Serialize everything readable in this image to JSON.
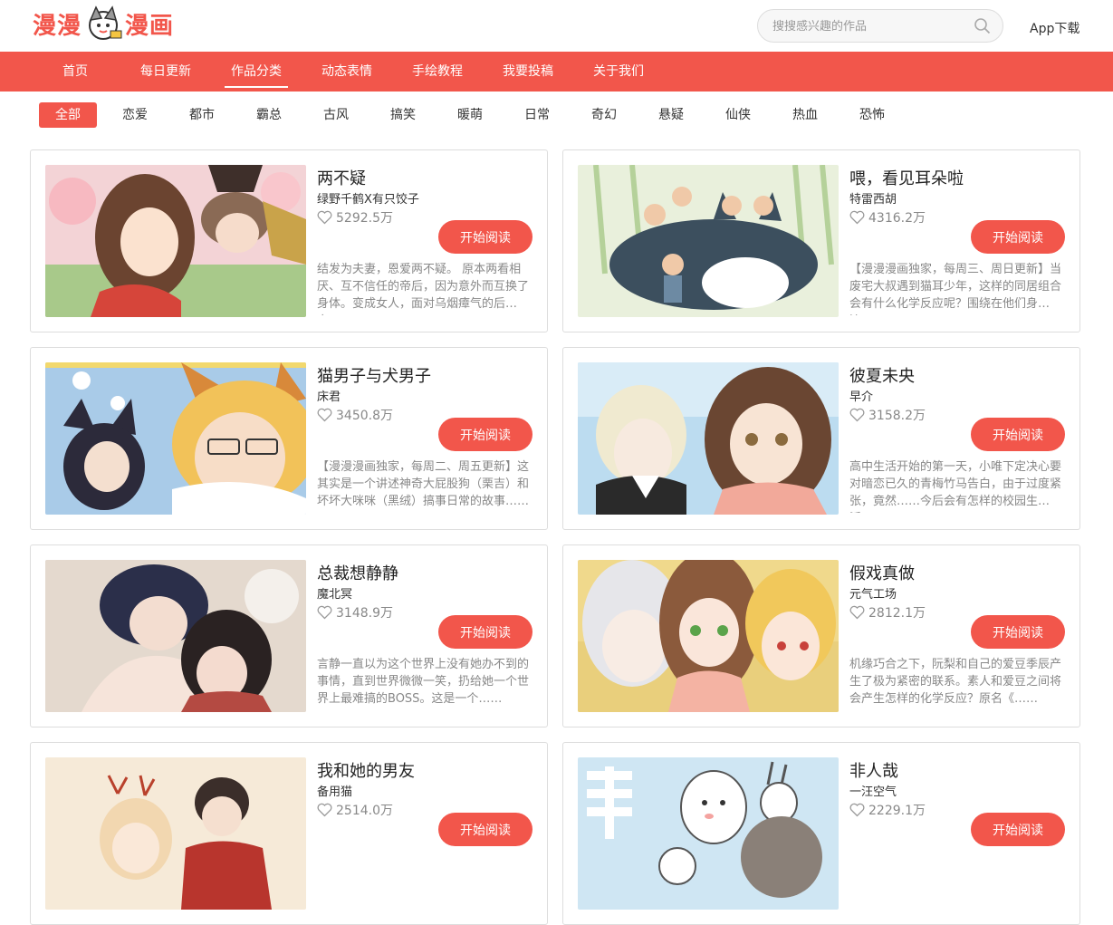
{
  "header": {
    "logo_left": "漫漫",
    "logo_right": "漫画",
    "search_placeholder": "搜搜感兴趣的作品",
    "app_download": "App下载"
  },
  "nav": {
    "items": [
      {
        "label": "首页"
      },
      {
        "label": "每日更新"
      },
      {
        "label": "作品分类",
        "active": true
      },
      {
        "label": "动态表情"
      },
      {
        "label": "手绘教程"
      },
      {
        "label": "我要投稿"
      },
      {
        "label": "关于我们"
      }
    ]
  },
  "categories": {
    "items": [
      "全部",
      "恋爱",
      "都市",
      "霸总",
      "古风",
      "搞笑",
      "暖萌",
      "日常",
      "奇幻",
      "悬疑",
      "仙侠",
      "热血",
      "恐怖"
    ],
    "active": "全部"
  },
  "button_label": "开始阅读",
  "comics": [
    {
      "title": "两不疑",
      "author": "绿野千鹤X有只饺子",
      "likes": "5292.5万",
      "desc": "结发为夫妻，恩爱两不疑。 原本两看相厌、互不信任的帝后，因为意外而互换了身体。变成女人，面对乌烟瘴气的后宫……"
    },
    {
      "title": "喂，看见耳朵啦",
      "author": "特雷西胡",
      "likes": "4316.2万",
      "desc": "【漫漫漫画独家，每周三、周日更新】当废宅大叔遇到猫耳少年，这样的同居组合会有什么化学反应呢？围绕在他们身边……"
    },
    {
      "title": "猫男子与犬男子",
      "author": "床君",
      "likes": "3450.8万",
      "desc": "【漫漫漫画独家，每周二、周五更新】这其实是一个讲述神奇大屁股狗（栗吉）和坏坏大咪咪（黑绒）搞事日常的故事……"
    },
    {
      "title": "彼夏未央",
      "author": "早介",
      "likes": "3158.2万",
      "desc": "高中生活开始的第一天，小唯下定决心要对暗恋已久的青梅竹马告白，由于过度紧张，竟然……今后会有怎样的校园生活……"
    },
    {
      "title": "总裁想静静",
      "author": "魔北冥",
      "likes": "3148.9万",
      "desc": "言静一直以为这个世界上没有她办不到的事情，直到世界微微一笑，扔给她一个世界上最难搞的BOSS。这是一个……"
    },
    {
      "title": "假戏真做",
      "author": "元气工场",
      "likes": "2812.1万",
      "desc": "机缘巧合之下，阮梨和自己的爱豆季辰产生了极为紧密的联系。素人和爱豆之间将会产生怎样的化学反应？原名《……"
    },
    {
      "title": "我和她的男友",
      "author": "备用猫",
      "likes": "2514.0万",
      "desc": ""
    },
    {
      "title": "非人哉",
      "author": "一汪空气",
      "likes": "2229.1万",
      "desc": ""
    }
  ],
  "colors": {
    "accent": "#f2564b"
  }
}
